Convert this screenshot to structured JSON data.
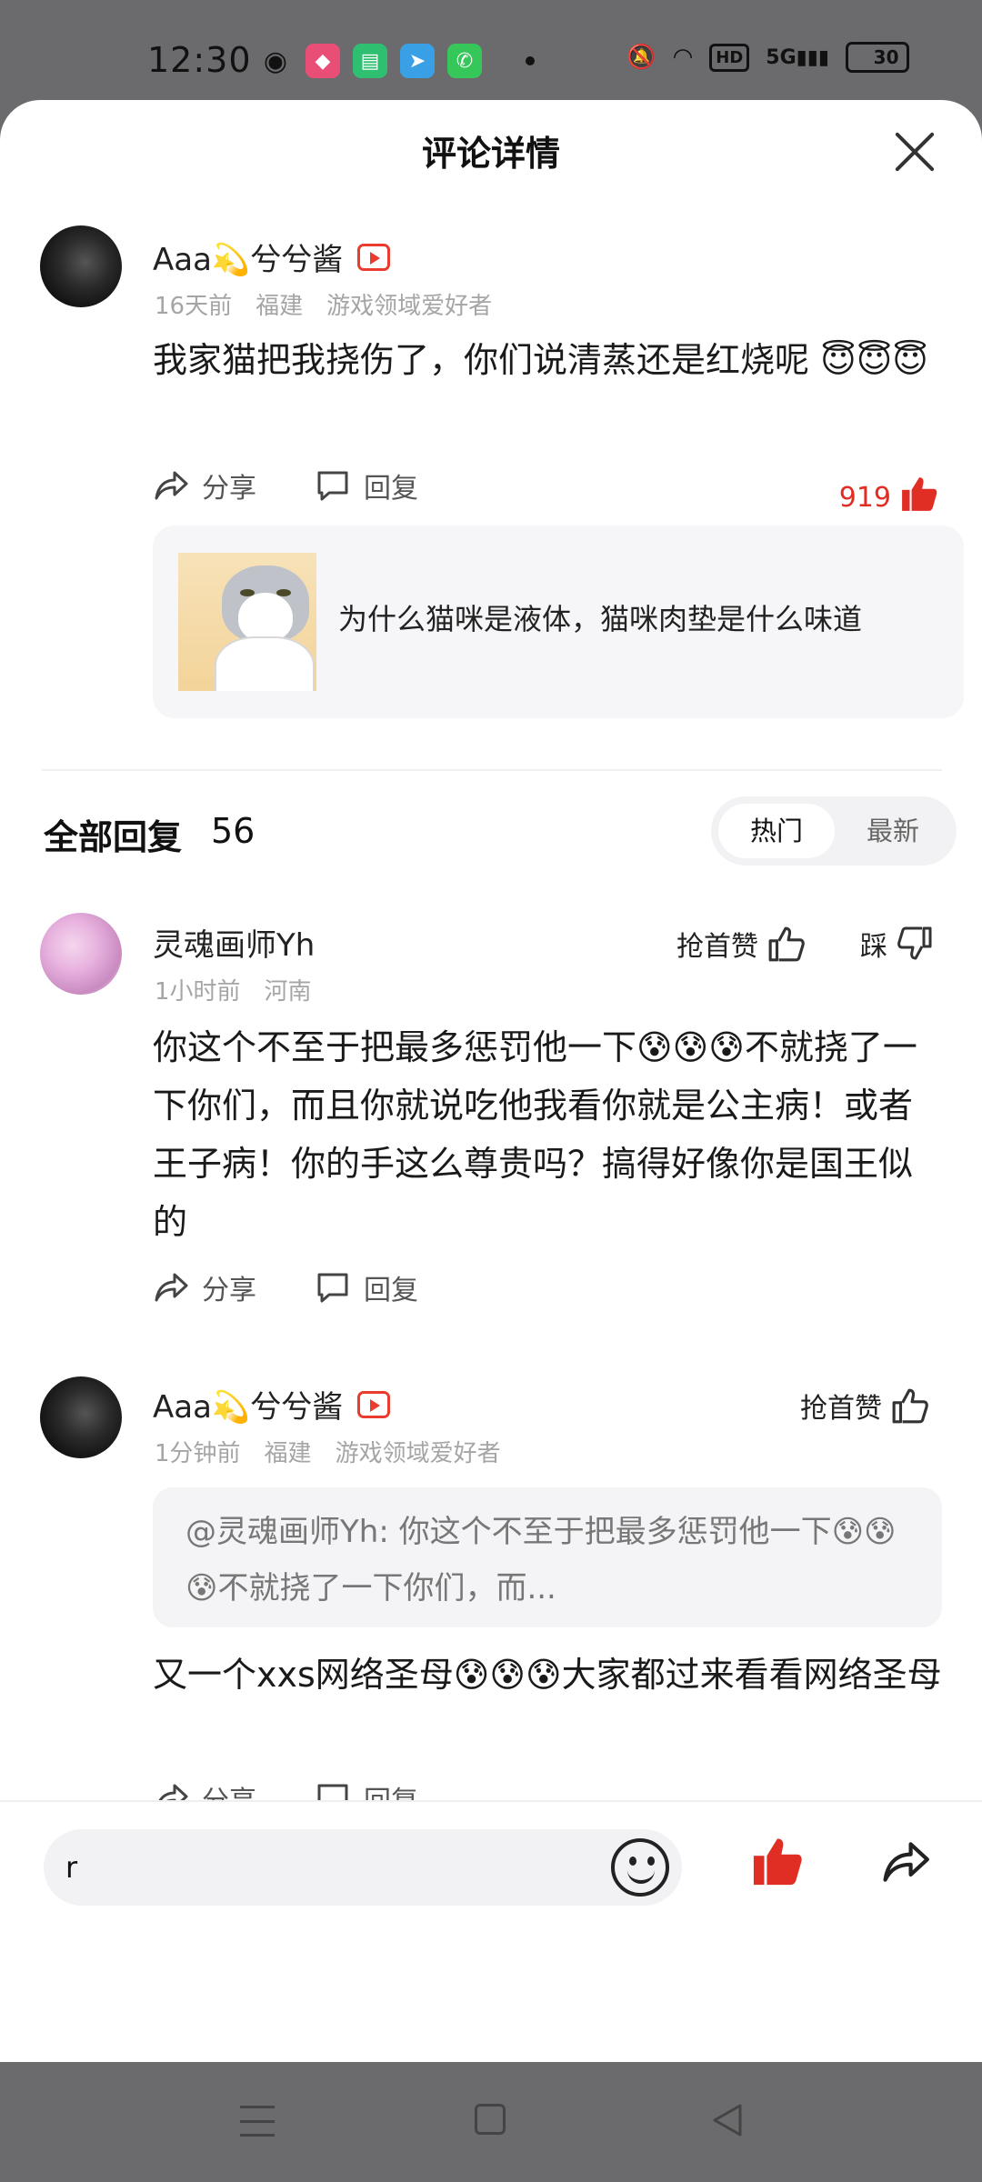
{
  "status_bar": {
    "time": "12:30",
    "battery": "30",
    "network": "5G",
    "hd": "HD"
  },
  "sheet": {
    "title": "评论详情"
  },
  "main_comment": {
    "username": "Aaa💫兮兮酱",
    "meta": [
      "16天前",
      "福建",
      "游戏领域爱好者"
    ],
    "text": "我家猫把我挠伤了，你们说清蒸还是红烧呢 😇😇😇",
    "share_label": "分享",
    "reply_label": "回复",
    "like_count": "919",
    "linked_topic": "为什么猫咪是液体，猫咪肉垫是什么味道"
  },
  "replies_header": {
    "title": "全部回复",
    "count": "56",
    "tab_hot": "热门",
    "tab_new": "最新"
  },
  "replies": [
    {
      "username": "灵魂画师Yh",
      "meta": [
        "1小时前",
        "河南"
      ],
      "like_label": "抢首赞",
      "dislike_label": "踩",
      "text": "你这个不至于把最多惩罚他一下😰😰😰不就挠了一下你们，而且你就说吃他我看你就是公主病！或者王子病！你的手这么尊贵吗？搞得好像你是国王似的",
      "share_label": "分享",
      "reply_label": "回复"
    },
    {
      "username": "Aaa💫兮兮酱",
      "meta": [
        "1分钟前",
        "福建",
        "游戏领域爱好者"
      ],
      "like_label": "抢首赞",
      "quote": "@灵魂画师Yh: 你这个不至于把最多惩罚他一下😰😰😰不就挠了一下你们，而...",
      "text": "又一个xxs网络圣母😰😰😰大家都过来看看网络圣母",
      "share_label": "分享",
      "reply_label": "回复"
    }
  ],
  "input_bar": {
    "value": "r"
  },
  "colors": {
    "accent_red": "#e02e24",
    "background_gray": "#6b6b6d"
  }
}
